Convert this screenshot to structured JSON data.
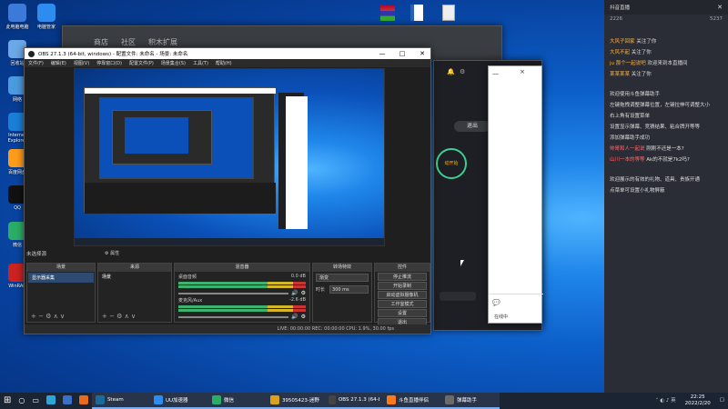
{
  "desktop_icons": [
    {
      "label": "此电脑电脑",
      "icon": "computer-icon"
    },
    {
      "label": "电脑管家",
      "icon": "shield-icon"
    },
    {
      "label": "回收站",
      "icon": "recycle-bin-icon"
    },
    {
      "label": "网络",
      "icon": "network-icon"
    },
    {
      "label": "Internet Explorer",
      "icon": "ie-icon"
    },
    {
      "label": "百度网盘",
      "icon": "cloud-icon"
    },
    {
      "label": "QQ",
      "icon": "qq-icon"
    },
    {
      "label": "微信",
      "icon": "wechat-icon"
    },
    {
      "label": "WinRAR",
      "icon": "winrar-icon"
    }
  ],
  "obs": {
    "title": "OBS 27.1.3 (64-bit, windows) - 配置文件: 未命名 - 场景: 未命名",
    "menu": [
      "文件(F)",
      "编辑(E)",
      "视图(V)",
      "停靠窗口(D)",
      "配置文件(P)",
      "场景集合(S)",
      "工具(T)",
      "帮助(H)"
    ],
    "no_source": "未选择源",
    "panels": {
      "scenes": "场景",
      "sources": "来源",
      "mixer": "混音器",
      "transitions": "转场特效",
      "controls": "控件"
    },
    "scene_item": "显示器采集",
    "source_item": "场景",
    "mixer": [
      {
        "name": "桌面音频",
        "value": "0.0 dB"
      },
      {
        "name": "麦克风/Aux",
        "value": "-2.6 dB"
      }
    ],
    "transition": {
      "type": "渐变",
      "duration_label": "时长",
      "duration": "300 ms"
    },
    "controls": [
      "停止推流",
      "开始录制",
      "启动虚拟摄像机",
      "工作室模式",
      "设置",
      "退出"
    ],
    "status": "LIVE: 00:00:00   REC: 00:00:00   CPU: 1.9%, 30.00 fps"
  },
  "bg_window": {
    "nav": [
      "商店",
      "社区",
      "积木扩展"
    ]
  },
  "live_panel": {
    "btn": "退出",
    "side": "动开始",
    "footer": "在线中"
  },
  "chat": {
    "header": "抖音直播",
    "stats": [
      "2226",
      "5237"
    ],
    "lines": [
      {
        "nick": "大风子回家",
        "text": "关注了你"
      },
      {
        "nick": "大风不起",
        "text": "关注了你"
      },
      {
        "nick": "ju 那个一起说吧",
        "text": "欢迎来到本直播间"
      },
      {
        "nick": "某某某某",
        "text": "关注了你"
      },
      {
        "nick": "",
        "text": "欢迎使用斗鱼弹幕助手"
      },
      {
        "nick": "",
        "text": "左键拖拽调整弹幕位置，左键拉伸可调整大小"
      },
      {
        "nick": "",
        "text": "右上角有设置菜单"
      },
      {
        "nick": "",
        "text": "设置显示弹幕、竞猜结果、粘合牌开等等"
      },
      {
        "nick": "",
        "text": "添加弹幕助手成功"
      },
      {
        "nick": "帅哥和人一起说",
        "text": "刚刚不还是一本?"
      },
      {
        "nick": "山川一本的等等",
        "text": "Ak的不就是7k2吗?"
      },
      {
        "nick": "",
        "text": "欢迎展示的有效的礼物、道具、贵族开通"
      },
      {
        "nick": "",
        "text": "点菜单可设置小礼物屏蔽"
      }
    ]
  },
  "taskbar": {
    "items": [
      {
        "label": "Steam",
        "color": "#1b6b9a"
      },
      {
        "label": "UU加速器",
        "color": "#2d8cf0"
      },
      {
        "label": "微信",
        "color": "#2aae67"
      },
      {
        "label": "39505423-迷野",
        "color": "#d9a21b"
      },
      {
        "label": "OBS 27.1.3 (64-bit...",
        "color": "#444444"
      },
      {
        "label": "斗鱼直播伴侣",
        "color": "#ff7a1c"
      },
      {
        "label": "弹幕助手",
        "color": "#6a6a6a"
      }
    ],
    "time": "22:25",
    "date": "2022/2/20"
  }
}
